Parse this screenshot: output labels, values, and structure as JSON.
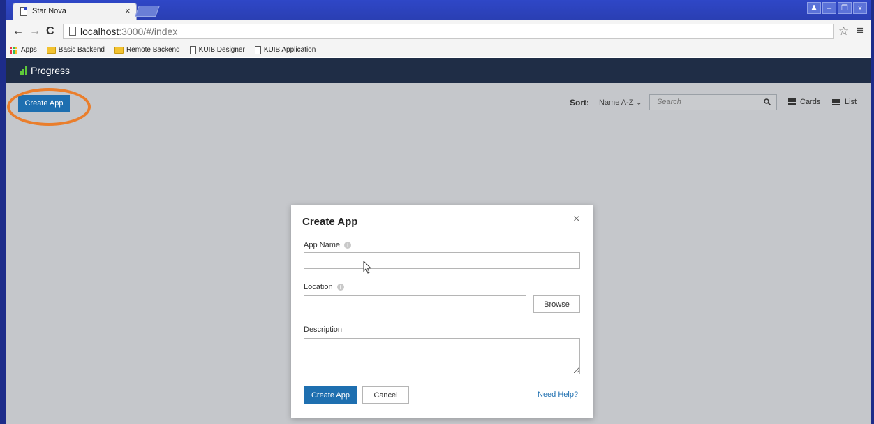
{
  "browser": {
    "tab_title": "Star Nova",
    "tab_close": "×",
    "url_host": "localhost",
    "url_path": ":3000/#/index",
    "bookmarks": [
      {
        "label": "Apps",
        "icon": "apps-grid-icon"
      },
      {
        "label": "Basic Backend",
        "icon": "folder-icon"
      },
      {
        "label": "Remote Backend",
        "icon": "folder-icon"
      },
      {
        "label": "KUIB Designer",
        "icon": "page-icon"
      },
      {
        "label": "KUIB Application",
        "icon": "page-icon"
      }
    ],
    "nav": {
      "back": "←",
      "forward": "→",
      "reload": "C"
    },
    "star": "☆",
    "menu": "≡",
    "window_controls": {
      "user": "♟",
      "minimize": "–",
      "restore": "❐",
      "close": "x"
    }
  },
  "app": {
    "logo_text": "Progress",
    "logo_sup": "'",
    "create_app_label": "Create App",
    "sort_label": "Sort:",
    "sort_value": "Name A-Z ⌄",
    "search_placeholder": "Search",
    "view_cards_label": "Cards",
    "view_list_label": "List",
    "colors": {
      "header": "#1f2d46",
      "primary": "#1e6fb0",
      "highlight": "#ea7e2c",
      "backdrop": "#c5c7cb"
    }
  },
  "modal": {
    "title": "Create App",
    "close": "×",
    "app_name_label": "App Name",
    "app_name_value": "",
    "location_label": "Location",
    "location_value": "",
    "browse_label": "Browse",
    "description_label": "Description",
    "description_value": "",
    "submit_label": "Create App",
    "cancel_label": "Cancel",
    "help_label": "Need Help?",
    "info_icon": "i"
  }
}
